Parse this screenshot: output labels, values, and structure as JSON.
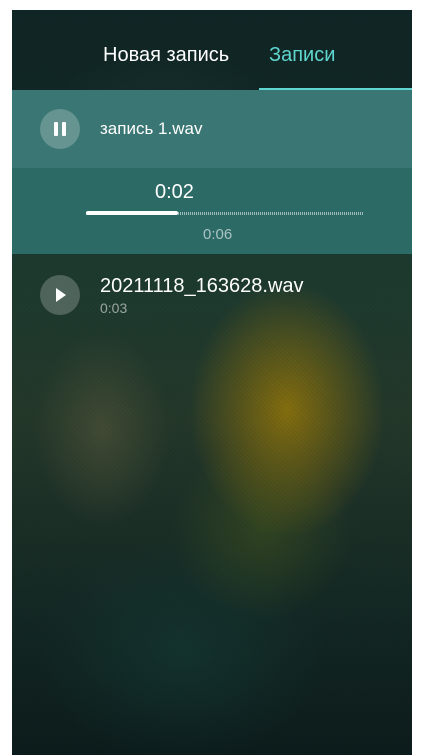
{
  "tabs": {
    "new_recording": "Новая запись",
    "recordings": "Записи",
    "active_color": "#5fd6cf"
  },
  "active_recording": {
    "title": "запись 1.wav",
    "state_icon": "pause-icon",
    "elapsed": "0:02",
    "duration": "0:06",
    "progress_fraction": 0.33
  },
  "recordings": [
    {
      "title": "20211118_163628.wav",
      "duration": "0:03",
      "icon": "play-icon"
    }
  ]
}
